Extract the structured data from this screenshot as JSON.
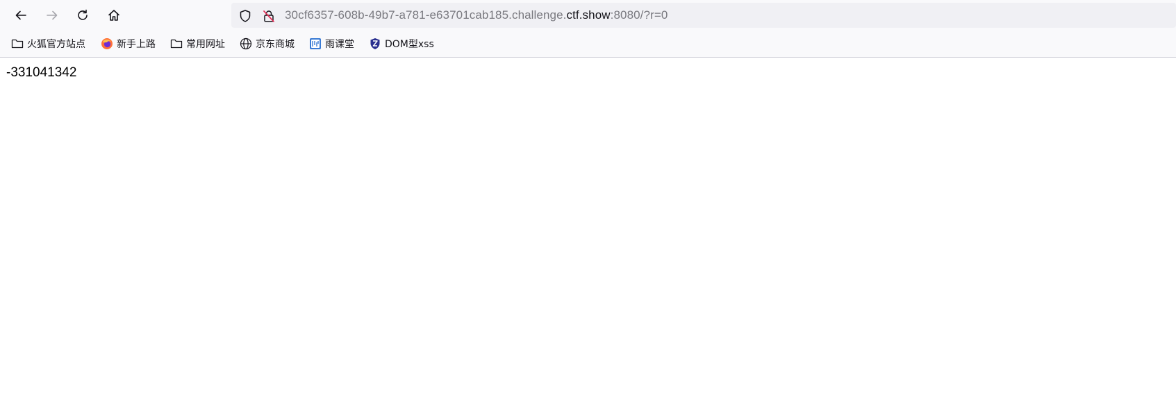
{
  "browser": {
    "nav": {
      "back_icon": "arrow-left-icon",
      "forward_icon": "arrow-right-icon",
      "reload_icon": "reload-icon",
      "home_icon": "home-icon"
    },
    "urlbar": {
      "prefix": "30cf6357-608b-49b7-a781-e63701cab185.challenge.",
      "domain": "ctf.show",
      "suffix": ":8080/?r=0",
      "shield_icon": "shield-icon",
      "insecure_icon": "insecure-lock-icon"
    },
    "bookmarks": [
      {
        "label": "火狐官方站点",
        "icon": "folder-icon"
      },
      {
        "label": "新手上路",
        "icon": "firefox-icon"
      },
      {
        "label": "常用网址",
        "icon": "folder-icon"
      },
      {
        "label": "京东商城",
        "icon": "globe-icon"
      },
      {
        "label": "雨课堂",
        "icon": "rain-classroom-icon"
      },
      {
        "label": "DOM型xss",
        "icon": "shield-logo-icon"
      }
    ]
  },
  "page": {
    "output_text": "-331041342"
  },
  "colors": {
    "toolbar_bg": "#f9f9fb",
    "urlbar_bg": "#f0f0f4",
    "url_dim_text": "#7a7a80",
    "url_domain_text": "#15141a",
    "firefox_orange": "#ff7139",
    "rain_blue": "#3a7bd5",
    "shield_navy": "#2a2f8f"
  }
}
